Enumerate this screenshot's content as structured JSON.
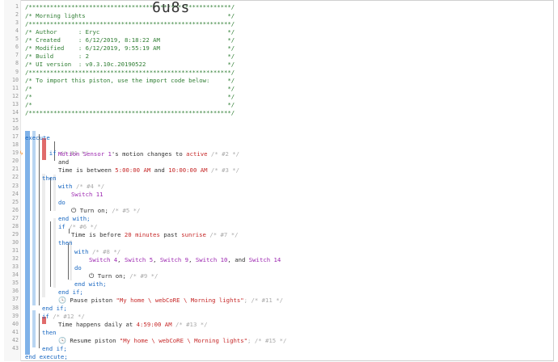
{
  "header": [
    "/*********************************************************/",
    "/* Morning lights                                        */",
    "/*********************************************************/",
    "/* Author      : Eryc                                    */",
    "/* Created     : 6/12/2019, 8:18:22 AM                   */",
    "/* Modified    : 6/12/2019, 9:55:19 AM                   */",
    "/* Build       : 2                                       */",
    "/* UI version  : v0.3.10c.20190522                       */",
    "/*********************************************************/",
    "/* To import this piston, use the import code below:     */",
    "/*                                                       */",
    "/*                                                       */",
    "/*                                                       */",
    "/*********************************************************/"
  ],
  "import_code": "6u8s",
  "line_numbers": [
    "1",
    "2",
    "3",
    "4",
    "5",
    "6",
    "7",
    "8",
    "9",
    "10",
    "11",
    "12",
    "13",
    "14",
    "15",
    "16",
    "17",
    "18",
    "19",
    "20",
    "21",
    "22",
    "23",
    "24",
    "25",
    "26",
    "27",
    "28",
    "29",
    "30",
    "31",
    "32",
    "33",
    "34",
    "35",
    "36",
    "37",
    "38",
    "39",
    "40",
    "41",
    "42",
    "43"
  ],
  "code": {
    "execute": "execute",
    "if1": "if",
    "if1_c": "/* #1 */",
    "l18_dev": "Motion Sensor 1",
    "l18_a": "'s motion changes to ",
    "l18_val": "active",
    "l18_c": " /* #2 */",
    "and": "and",
    "l20_a": "Time is between ",
    "l20_v1": "5:00:00 AM",
    "l20_b": " and ",
    "l20_v2": "10:00:00 AM",
    "l20_c": " /* #3 */",
    "then1": "then",
    "with4": "with",
    "with4_c": "/* #4 */",
    "sw11": "Switch 11",
    "do1": "do",
    "turnon1": "Turn on;",
    "turnon1_c": " /* #5 */",
    "endwith1": "end with;",
    "if6": "if",
    "if6_c": "/* #6 */",
    "l28_a": "Time is before ",
    "l28_v": "20 minutes",
    "l28_b": " past ",
    "l28_v2": "sunrise",
    "l28_c": " /* #7 */",
    "then2": "then",
    "with8": "with",
    "with8_c": "/* #8 */",
    "l31_s1": "Switch 4",
    "l31_s2": "Switch 5",
    "l31_s3": "Switch 9",
    "l31_s4": "Switch 10",
    "l31_s5": "Switch 14",
    "comma": ", ",
    "and_sep": ", and ",
    "do2": "do",
    "turnon2": "Turn on;",
    "turnon2_c": " /* #9 */",
    "endwith2": "end with;",
    "endif1": "end if;",
    "pause_a": "Pause piston ",
    "pause_s": "\"My home \\ webCoRE \\ Morning lights\"",
    "pause_c": "; /* #11 */",
    "endif2": "end if;",
    "if12": "if",
    "if12_c": "/* #12 */",
    "l39_a": "Time happens daily at ",
    "l39_v": "4:59:00 AM",
    "l39_c": " /* #13 */",
    "then3": "then",
    "resume_a": "Resume piston ",
    "resume_s": "\"My home \\ webCoRE \\ Morning lights\"",
    "resume_c": "; /* #15 */",
    "endif3": "end if;",
    "endexec": "end execute;"
  },
  "icons": {
    "power": "power-icon",
    "clock": "clock-icon",
    "trigger": "lightning-bolt-icon"
  },
  "colors": {
    "comment": "#2e7d32",
    "keyword": "#1565c0",
    "device": "#9c27b0",
    "value": "#c62828",
    "execute_bar": "#7fb2e8",
    "trigger_bar": "#e06b6b"
  }
}
